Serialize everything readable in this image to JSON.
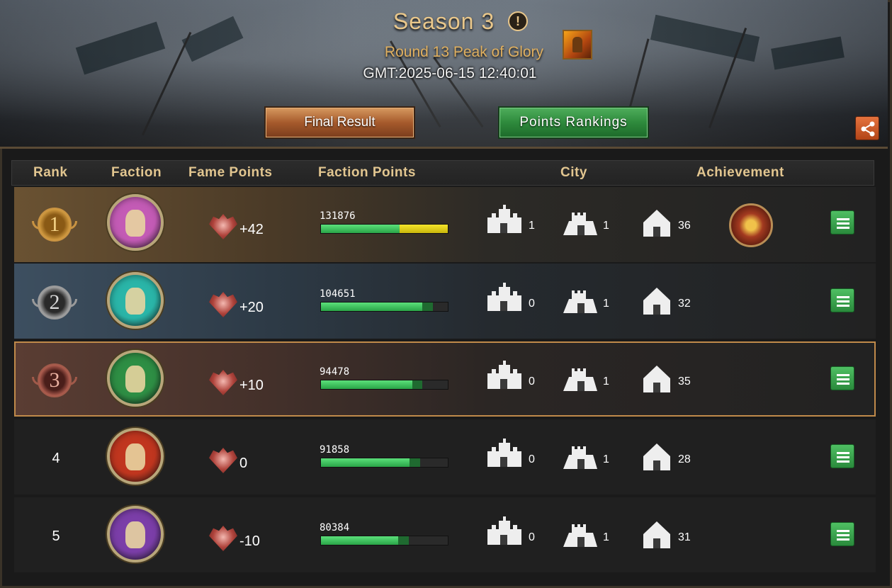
{
  "header": {
    "title": "Season 3",
    "info_icon": "!",
    "subtitle": "Round 13 Peak of Glory",
    "timestamp": "GMT:2025-06-15 12:40:01",
    "final_result_label": "Final Result",
    "points_rankings_label": "Points Rankings"
  },
  "columns": {
    "rank": "Rank",
    "faction": "Faction",
    "fame_points": "Fame Points",
    "faction_points": "Faction Points",
    "city": "City",
    "achievement": "Achievement"
  },
  "rows": [
    {
      "rank": "1",
      "faction_color": "#c35bb5",
      "fame": "+42",
      "points": "131876",
      "bar_green": 0.62,
      "bar_yellow": 0.38,
      "city_large": "1",
      "city_medium": "1",
      "city_small": "36",
      "has_achievement": true
    },
    {
      "rank": "2",
      "faction_color": "#2ab5a8",
      "fame": "+20",
      "points": "104651",
      "bar_green": 0.8,
      "city_large": "0",
      "city_medium": "1",
      "city_small": "32",
      "has_achievement": false
    },
    {
      "rank": "3",
      "faction_color": "#2e8e44",
      "fame": "+10",
      "points": "94478",
      "bar_green": 0.72,
      "city_large": "0",
      "city_medium": "1",
      "city_small": "35",
      "has_achievement": false
    },
    {
      "rank": "4",
      "faction_color": "#c0361f",
      "fame": "0",
      "points": "91858",
      "bar_green": 0.7,
      "city_large": "0",
      "city_medium": "1",
      "city_small": "28",
      "has_achievement": false
    },
    {
      "rank": "5",
      "faction_color": "#7b3ea8",
      "fame": "-10",
      "points": "80384",
      "bar_green": 0.61,
      "city_large": "0",
      "city_medium": "1",
      "city_small": "31",
      "has_achievement": false
    }
  ],
  "icons": {
    "fame": "fame-heart-icon",
    "city_large": "castle-icon",
    "city_medium": "fort-icon",
    "city_small": "gate-icon",
    "details": "list-icon",
    "share": "share-icon"
  },
  "colors": {
    "accent_gold": "#e9c78b",
    "button_green": "#2e8a3c",
    "button_brown": "#a65a2c",
    "bar_green": "#2aa548",
    "bar_yellow": "#f5e52a"
  }
}
